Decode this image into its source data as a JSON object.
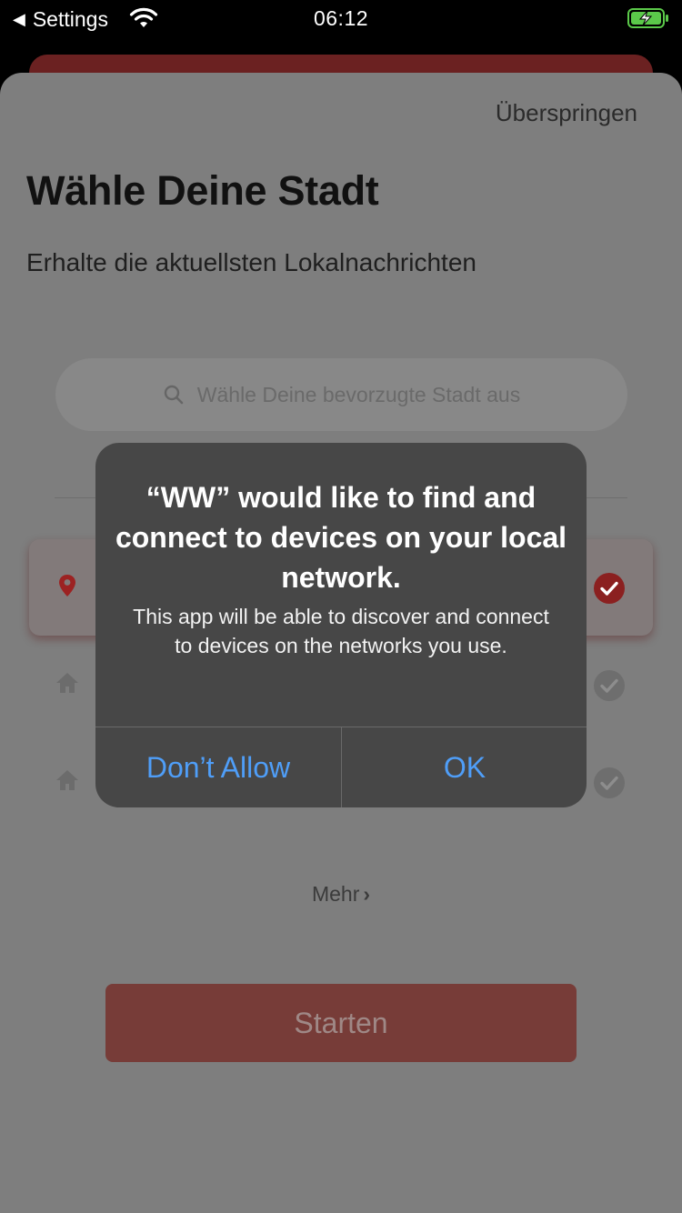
{
  "status_bar": {
    "back_label": "Settings",
    "time": "06:12"
  },
  "sheet": {
    "skip_label": "Überspringen",
    "title": "Wähle Deine Stadt",
    "subtitle": "Erhalte die aktuellsten Lokalnachrichten",
    "search_placeholder": "Wähle Deine bevorzugte Stadt aus",
    "more_label": "Mehr",
    "start_label": "Starten",
    "city_rows": [
      {
        "icon": "location-pin-icon",
        "selected": true
      },
      {
        "icon": "home-icon",
        "selected": false
      },
      {
        "icon": "home-icon",
        "selected": false
      }
    ]
  },
  "alert": {
    "title": "“WW” would like to find and connect to devices on your local network.",
    "message": "This app will be able to discover and connect to devices on the networks you use.",
    "deny_label": "Don’t Allow",
    "ok_label": "OK"
  },
  "colors": {
    "accent_red": "#c42b2b",
    "alert_button_blue": "#4f9ef8",
    "dim_overlay_bg": "#7e7e7e"
  }
}
